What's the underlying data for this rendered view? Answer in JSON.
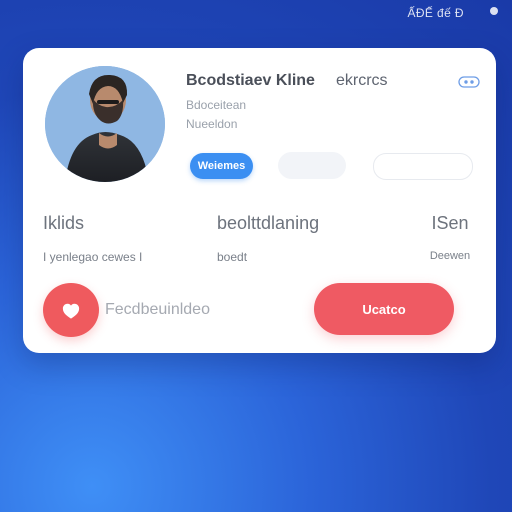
{
  "status_bar": {
    "text": "ẤĐẾ đế Đ",
    "icon": "status-dot-icon"
  },
  "profile": {
    "name": "Bcodstiaev Kline",
    "name_accent": "ekrcrcs",
    "subtitle": "Bdoceitean",
    "handle": "Nueeldon",
    "verified_icon": "verified-icon"
  },
  "pills": {
    "primary_label": "Weiemes"
  },
  "stats": [
    {
      "label": "Iklids",
      "value": "I yenlegao cewes I"
    },
    {
      "label": "beolttdlaning",
      "value": "boedt"
    },
    {
      "label": "ISen",
      "value": "Deewen"
    }
  ],
  "actions": {
    "favorite_label": "Fecdbeuinldeo",
    "primary_button_label": "Ucatco"
  },
  "colors": {
    "background": "#1f47b8",
    "card": "#ffffff",
    "primary_blue": "#3b8ff2",
    "accent_red": "#ef5a5e",
    "text_dark": "#4a4f59",
    "text_muted": "#9aa1ab"
  }
}
